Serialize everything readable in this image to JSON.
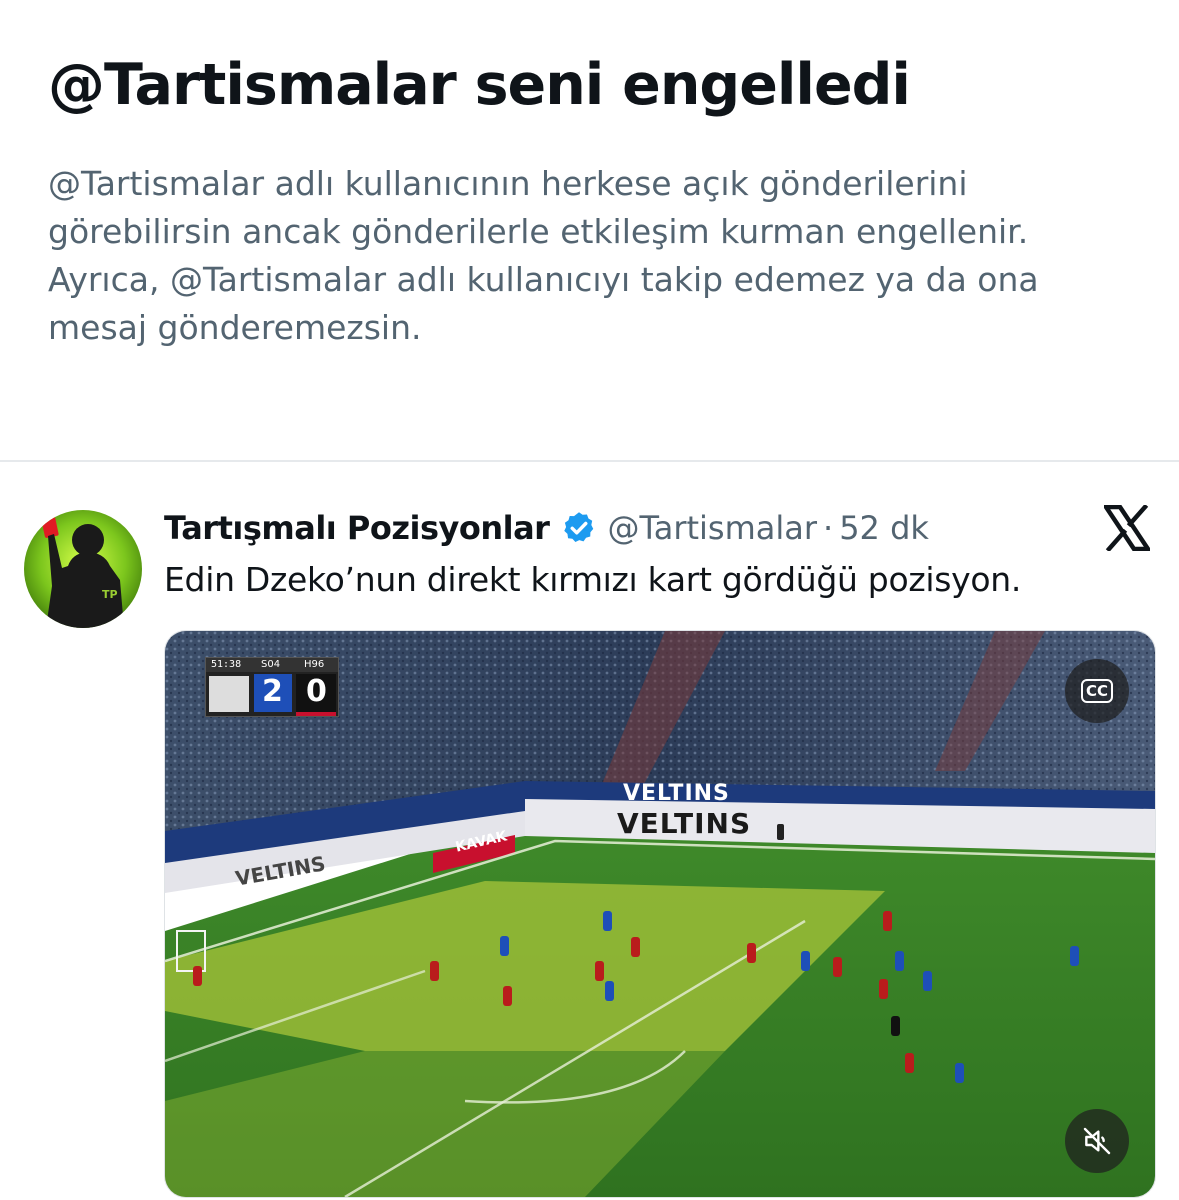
{
  "blocked": {
    "title": "@Tartismalar seni engelledi",
    "description": "@Tartismalar adlı kullanıcının herkese açık gönderilerini görebilirsin ancak gönderilerle etkileşim kurman engellenir. Ayrıca, @Tartismalar adlı kullanıcıyı takip edemez ya da ona mesaj gönderemezsin."
  },
  "tweet": {
    "display_name": "Tartışmalı Pozisyonlar",
    "handle": "@Tartismalar",
    "separator": "·",
    "time": "52 dk",
    "text": "Edin Dzeko’nun direkt kırmızı kart gördüğü pozisyon.",
    "avatar_initials": "TP",
    "verified_color": "#1d9bf0"
  },
  "video": {
    "scoreboard": {
      "clock": "51:38",
      "home": "S04",
      "away": "H96",
      "home_score": "2",
      "away_score": "0"
    },
    "sponsor": "VELTINS",
    "board_kavak": "KAVAK",
    "cc_label": "CC",
    "icons": {
      "captions": "cc-icon",
      "mute": "muted-speaker-icon",
      "platform": "x-logo-icon"
    }
  }
}
